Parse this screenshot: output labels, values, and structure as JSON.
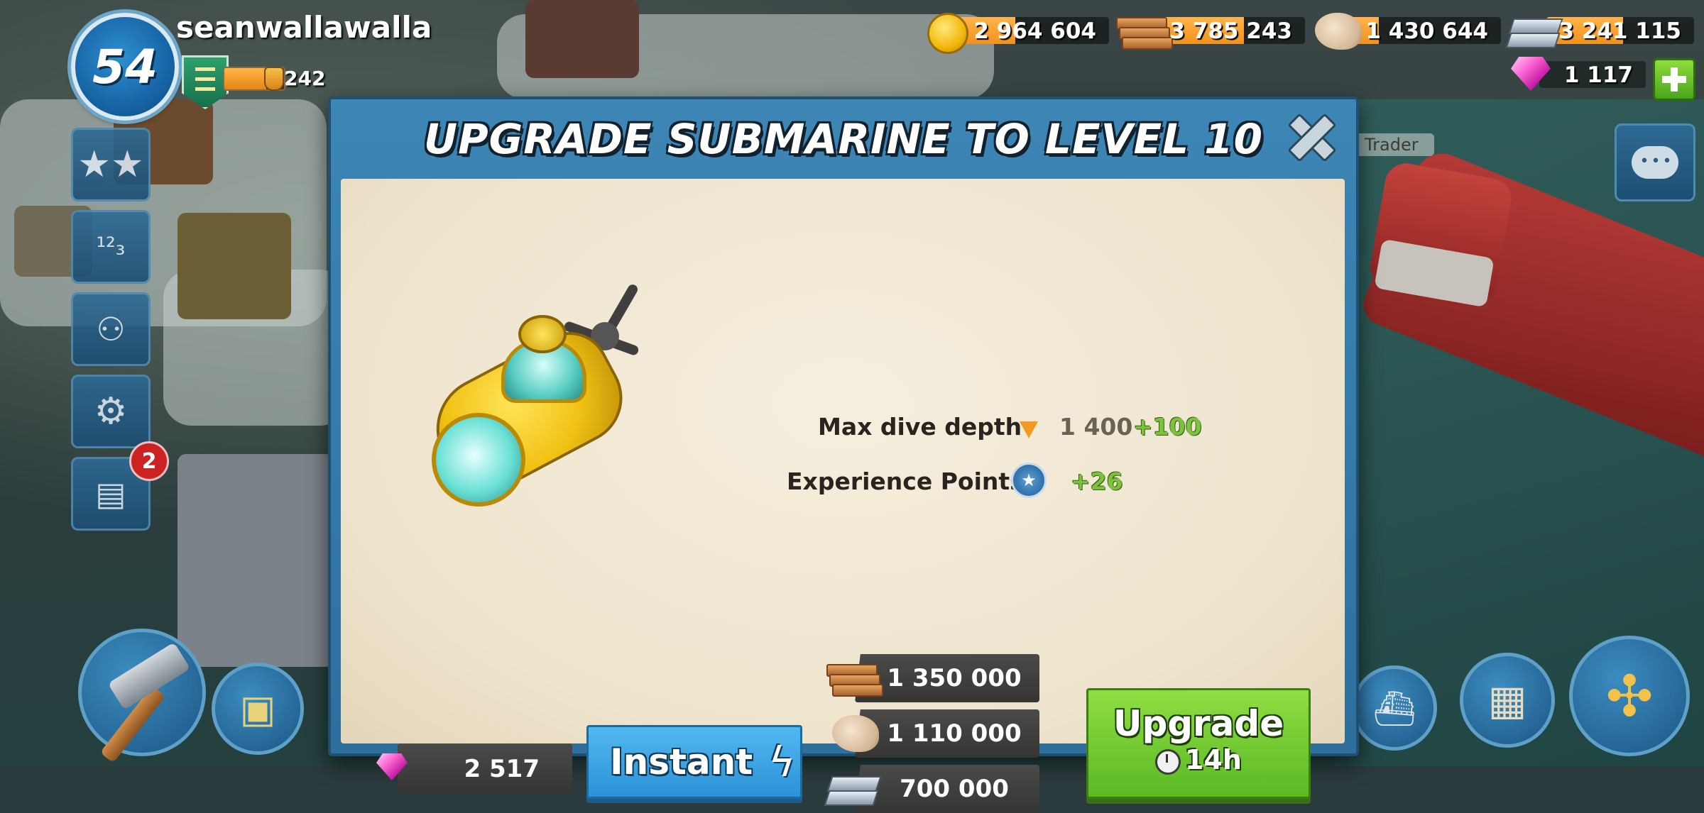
{
  "player": {
    "level": "54",
    "username": "seanwallawalla",
    "xp_value": "242",
    "xp_progress": 0.7
  },
  "resources": {
    "gold": "2 964 604",
    "wood": "3 785 243",
    "stone": "1 430 644",
    "iron": "3 241 115",
    "diamonds": "1 117"
  },
  "side_menu": {
    "notification_count": "2"
  },
  "scene": {
    "trader_label": "Trader"
  },
  "dialog": {
    "title": "UPGRADE SUBMARINE TO LEVEL 10",
    "stats": [
      {
        "label": "Max dive depth",
        "value": "1 400",
        "bonus": "+100",
        "icon": "depth-arrow-icon"
      },
      {
        "label": "Experience Points",
        "value": "",
        "bonus": "+26",
        "icon": "xp-star-icon"
      }
    ],
    "costs": {
      "wood": "1 350 000",
      "stone": "1 110 000",
      "iron": "700 000"
    },
    "instant": {
      "gem_cost": "2 517",
      "label": "Instant"
    },
    "upgrade": {
      "label": "Upgrade",
      "time": "14h"
    }
  },
  "colors": {
    "dialog_frame": "#3d86b6",
    "paper": "#f1e8d4",
    "upgrade_green": "#6cc82e",
    "instant_blue": "#3ea6e6",
    "bonus_green": "#7bc33a",
    "resource_bar": "#f2911e"
  }
}
